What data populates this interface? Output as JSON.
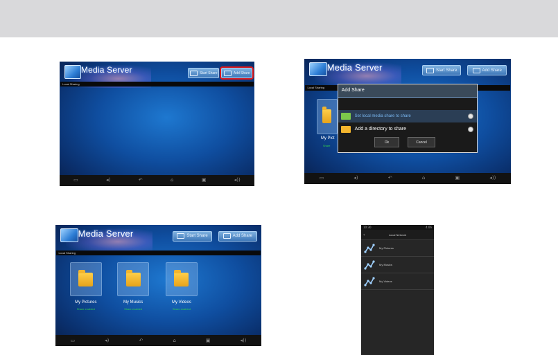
{
  "panels": [
    {
      "app_title": "Media Server",
      "buttons": [
        "Start Share",
        "Add Share"
      ],
      "section": "Local Sharing"
    },
    {
      "app_title": "Media Server",
      "buttons": [
        "Start Share",
        "Add Share"
      ],
      "section": "Local Sharing",
      "folder": {
        "label": "My Pict",
        "status": "Share"
      },
      "dialog": {
        "title": "Add Share",
        "options": [
          "Set local media share to share",
          "Add a directory to share"
        ],
        "buttons": [
          "Ok",
          "Cancel"
        ]
      }
    },
    {
      "app_title": "Media Server",
      "buttons": [
        "Start Share",
        "Add Share"
      ],
      "section": "Local Sharing",
      "folders": [
        {
          "label": "My Pictures",
          "status": "Share enabled"
        },
        {
          "label": "My Musics",
          "status": "Share enabled"
        },
        {
          "label": "My Videos",
          "status": "Share enabled"
        }
      ]
    },
    {
      "status_left": "10:30",
      "status_right": "4:06",
      "header": "Local Network",
      "items": [
        "My Pictures",
        "My Musics",
        "My Videos"
      ]
    }
  ],
  "navbar_icons": [
    "screenshot-icon",
    "volume-down-icon",
    "back-icon",
    "home-icon",
    "recent-apps-icon",
    "volume-up-icon"
  ],
  "colors": {
    "highlight": "#d8161b",
    "status_green": "#33d34a",
    "dialog_accent": "#7ab7f0"
  }
}
